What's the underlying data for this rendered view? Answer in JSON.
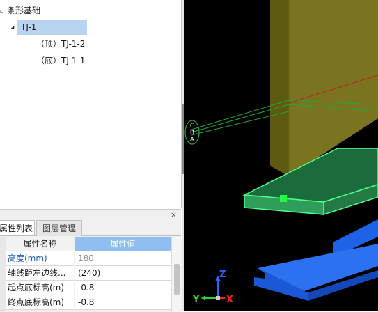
{
  "tree": {
    "root_label": "条形基础",
    "root_toggle": "▫",
    "selected_item_label": "TJ-1",
    "selected_toggle": "◢",
    "children": [
      {
        "label": "（顶）TJ-1-2"
      },
      {
        "label": "（底）TJ-1-1"
      }
    ]
  },
  "properties": {
    "close_glyph": "×",
    "tabs": [
      {
        "label": "属性列表",
        "active": true
      },
      {
        "label": "图层管理",
        "active": false
      }
    ],
    "header": {
      "name_col": "属性名称",
      "value_col": "属性值"
    },
    "rows": [
      {
        "name": "高度(mm)",
        "value": "180"
      },
      {
        "name": "轴线距左边线...",
        "value": "(240)"
      },
      {
        "name": "起点底标高(m)",
        "value": "-0.8"
      },
      {
        "name": "终点底标高(m)",
        "value": "-0.8"
      }
    ]
  },
  "viewport": {
    "background": "#000000",
    "column_color": "#7a7420",
    "beam_color": "#2f9e5a",
    "foundation_color": "#1f5fe0",
    "selection_color": "#4dff8a",
    "axis_marker_text": "C\nB\nA",
    "gizmo": {
      "z_label": "Z",
      "y_label": "Y",
      "x_label": "X"
    },
    "axis_colors": {
      "z": "#3060ff",
      "y": "#30d030",
      "x": "#ff2020"
    }
  }
}
